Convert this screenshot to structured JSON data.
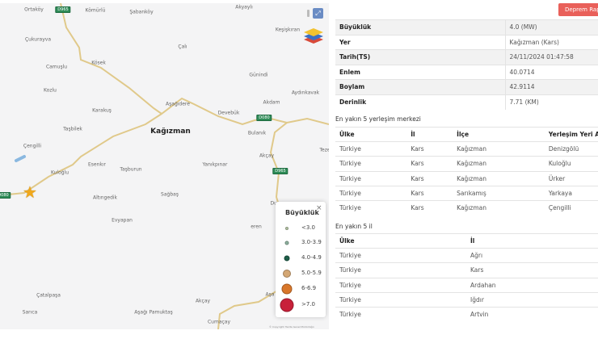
{
  "map": {
    "labels": [
      "Ortaköy",
      "Kömürlü",
      "Şabanköy",
      "Akyaylı",
      "Çukurayva",
      "Keşişkıran",
      "Çalı",
      "Kösek",
      "Camuşlu",
      "Günindi",
      "Kozlu",
      "Aydınkavak",
      "Akdam",
      "Aşağıdere",
      "Karakuş",
      "Devebük",
      "Taşbilek",
      "Kağızman",
      "Bulanık",
      "Çengilli",
      "Teze",
      "Akçay",
      "Esenkır",
      "Taşburun",
      "Yanıkpınar",
      "Kuloğlu",
      "Altıngedik",
      "Sağbaş",
      "Dur",
      "Evyapan",
      "eren",
      "Çatalpaşa",
      "Akçay",
      "Sarıca",
      "Aşağı Pamuktaş",
      "Cumaçay",
      "Aşa"
    ],
    "road_badges": [
      "D965",
      "D080",
      "D965",
      "D080"
    ],
    "epicenter_icon": "star-icon",
    "fullscreen_icon": "expand-icon",
    "layers_icon": "layers-icon",
    "copyright": "© Copyright Harita Genel Müdürlüğü"
  },
  "legend": {
    "title": "Büyüklük",
    "close": "×",
    "items": [
      {
        "label": "<3.0",
        "color": "#b8c9a8"
      },
      {
        "label": "3.0-3.9",
        "color": "#8fb3a0"
      },
      {
        "label": "4.0-4.9",
        "color": "#1e5e48"
      },
      {
        "label": "5.0-5.9",
        "color": "#d4a774"
      },
      {
        "label": "6-6.9",
        "color": "#d9772a"
      },
      {
        "label": ">7.0",
        "color": "#c8213a"
      }
    ]
  },
  "report_button": "Deprem Raporu",
  "info": [
    {
      "k": "Büyüklük",
      "v": "4.0 (MW)"
    },
    {
      "k": "Yer",
      "v": "Kağızman (Kars)"
    },
    {
      "k": "Tarih(TS)",
      "v": "24/11/2024 01:47:58"
    },
    {
      "k": "Enlem",
      "v": "40.0714"
    },
    {
      "k": "Boylam",
      "v": "42.9114"
    },
    {
      "k": "Derinlik",
      "v": "7.71 (KM)"
    }
  ],
  "settlements": {
    "title": "En yakın 5 yerleşim merkezi",
    "headers": [
      "Ülke",
      "İl",
      "İlçe",
      "Yerleşim Yeri Adı"
    ],
    "rows": [
      [
        "Türkiye",
        "Kars",
        "Kağızman",
        "Denizgölü"
      ],
      [
        "Türkiye",
        "Kars",
        "Kağızman",
        "Kuloğlu"
      ],
      [
        "Türkiye",
        "Kars",
        "Kağızman",
        "Ürker"
      ],
      [
        "Türkiye",
        "Kars",
        "Sarıkamış",
        "Yarkaya"
      ],
      [
        "Türkiye",
        "Kars",
        "Kağızman",
        "Çengilli"
      ]
    ]
  },
  "provinces": {
    "title": "En yakın 5 il",
    "headers": [
      "Ülke",
      "İl"
    ],
    "rows": [
      [
        "Türkiye",
        "Ağrı"
      ],
      [
        "Türkiye",
        "Kars"
      ],
      [
        "Türkiye",
        "Ardahan"
      ],
      [
        "Türkiye",
        "Iğdır"
      ],
      [
        "Türkiye",
        "Artvin"
      ]
    ]
  }
}
